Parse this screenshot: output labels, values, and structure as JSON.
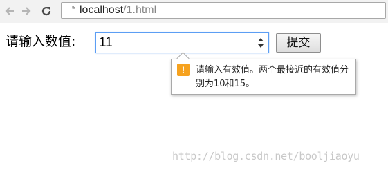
{
  "browser": {
    "url_host": "localhost",
    "url_path": "/1.html"
  },
  "form": {
    "label": "请输入数值:",
    "number_value": "11",
    "submit_label": "提交"
  },
  "validation": {
    "icon": "warning-icon",
    "icon_glyph": "!",
    "message": "请输入有效值。两个最接近的有效值分别为10和15。",
    "accent_color": "#f6a21f"
  },
  "watermark": "http://blog.csdn.net/booljiaoyu"
}
